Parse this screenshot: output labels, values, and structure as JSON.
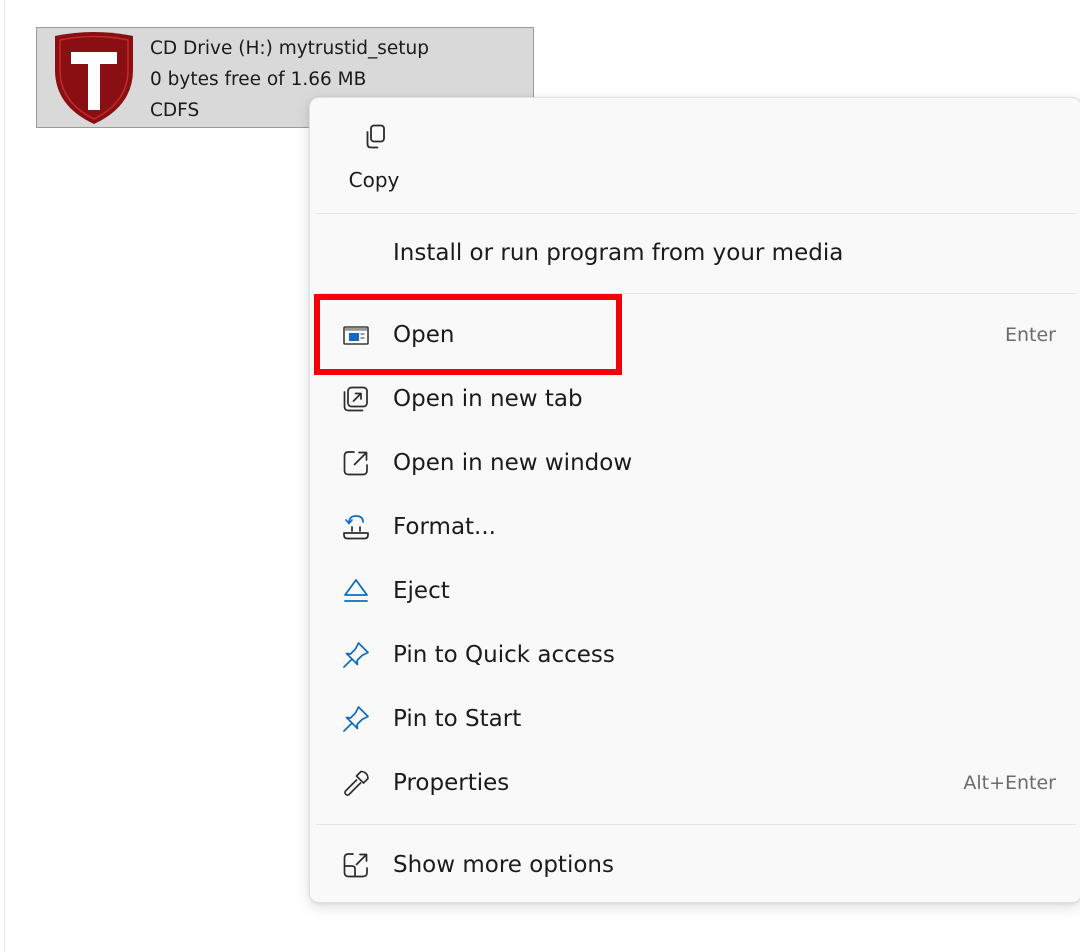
{
  "drive": {
    "name": "CD Drive (H:) mytrustid_setup",
    "space": "0 bytes free of 1.66 MB",
    "filesystem": "CDFS",
    "icon": "trustid-shield-icon"
  },
  "menu": {
    "copy": {
      "label": "Copy",
      "icon": "copy-icon"
    },
    "install": {
      "label": "Install or run program from your media"
    },
    "items": [
      {
        "label": "Open",
        "shortcut": "Enter",
        "icon": "open-window-icon"
      },
      {
        "label": "Open in new tab",
        "shortcut": "",
        "icon": "new-tab-icon"
      },
      {
        "label": "Open in new window",
        "shortcut": "",
        "icon": "new-window-icon"
      },
      {
        "label": "Format...",
        "shortcut": "",
        "icon": "format-icon"
      },
      {
        "label": "Eject",
        "shortcut": "",
        "icon": "eject-icon"
      },
      {
        "label": "Pin to Quick access",
        "shortcut": "",
        "icon": "pin-icon"
      },
      {
        "label": "Pin to Start",
        "shortcut": "",
        "icon": "pin-icon"
      },
      {
        "label": "Properties",
        "shortcut": "Alt+Enter",
        "icon": "wrench-icon"
      }
    ],
    "more": {
      "label": "Show more options",
      "icon": "show-more-icon"
    }
  },
  "colors": {
    "accent": "#0f6cbd",
    "highlight": "#f5000a",
    "shield": "#8a0f12"
  }
}
